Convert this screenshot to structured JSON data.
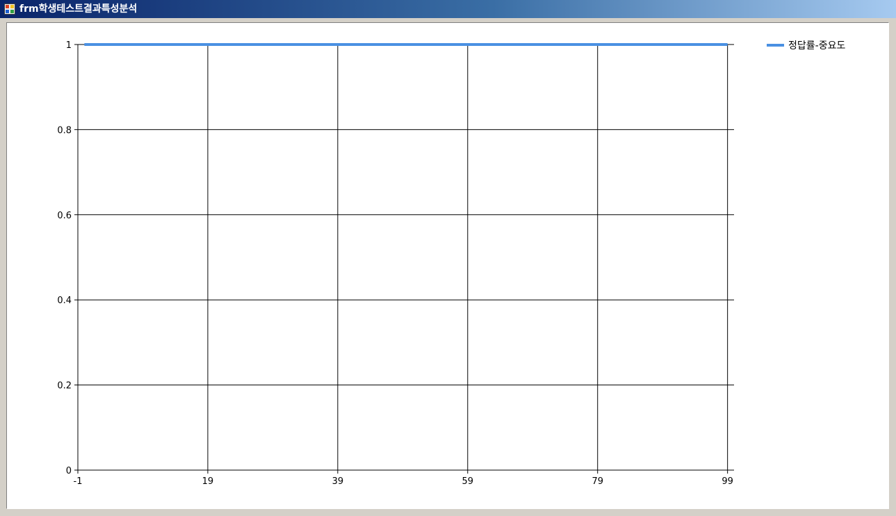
{
  "window": {
    "title": "frm학생테스트결과특성분석",
    "icon": "form-app-icon"
  },
  "chart_data": {
    "type": "line",
    "title": "",
    "xlabel": "",
    "ylabel": "",
    "x_ticks": [
      "-1",
      "19",
      "39",
      "59",
      "79",
      "99"
    ],
    "y_ticks": [
      "0",
      "0.2",
      "0.4",
      "0.6",
      "0.8",
      "1"
    ],
    "xlim": [
      -1,
      100
    ],
    "ylim": [
      0,
      1
    ],
    "grid": true,
    "legend": "top-right",
    "series": [
      {
        "name": "정답률-중요도",
        "color": "#4a90e2",
        "x": [
          0,
          99
        ],
        "y": [
          1,
          1
        ]
      }
    ]
  }
}
